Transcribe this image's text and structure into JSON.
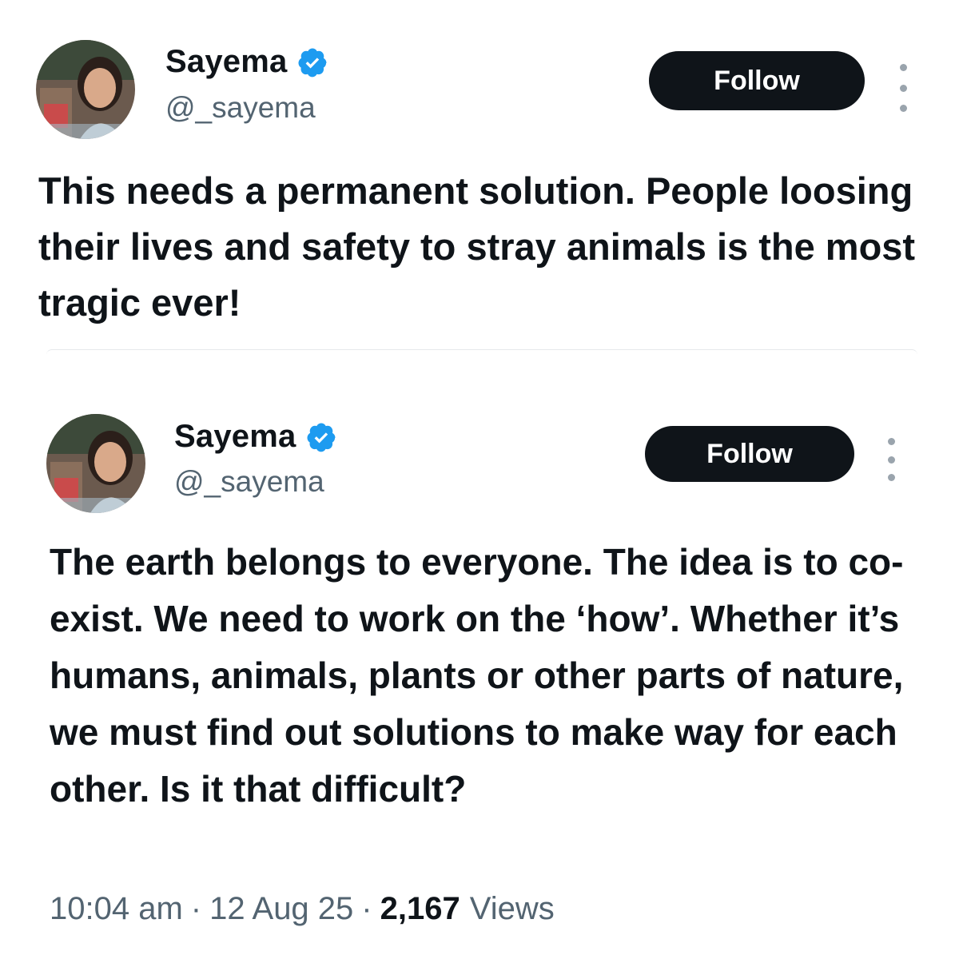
{
  "quote_tweet": {
    "display_name": "Sayema",
    "handle": "@_sayema",
    "verified_icon": "verified-badge-icon",
    "follow_label": "Follow",
    "text": "This needs a permanent solution. People loosing their lives and safety to stray animals is the most tragic ever!"
  },
  "original_tweet": {
    "display_name": "Sayema",
    "handle": "@_sayema",
    "verified_icon": "verified-badge-icon",
    "follow_label": "Follow",
    "text": "The earth belongs to everyone. The idea is to co-exist. We need to work on the ‘how’. Whether it’s humans, animals, plants or other parts of nature, we must find out solutions to make way for each other. Is it that difficult?",
    "time": "10:04 am",
    "date": "12 Aug 25",
    "views_count": "2,167",
    "views_label": "Views"
  },
  "colors": {
    "verified_blue": "#1d9bf0",
    "button_bg": "#0f1419",
    "muted_text": "#536471"
  }
}
